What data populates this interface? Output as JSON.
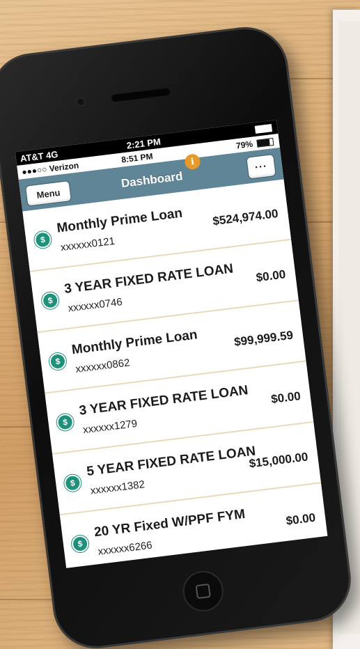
{
  "outer_status": {
    "carrier": "AT&T 4G",
    "time": "2:21 PM"
  },
  "inner_status": {
    "carrier": "●●●○○ Verizon",
    "time": "8:51 PM",
    "battery_text": "79%"
  },
  "header": {
    "title": "Dashboard",
    "menu_label": "Menu",
    "more_label": "···",
    "badge_label": "i"
  },
  "accounts": [
    {
      "name": "Monthly Prime Loan",
      "number": "xxxxxx0121",
      "balance": "$524,974.00"
    },
    {
      "name": "3 YEAR FIXED RATE LOAN",
      "number": "xxxxxx0746",
      "balance": "$0.00"
    },
    {
      "name": "Monthly Prime Loan",
      "number": "xxxxxx0862",
      "balance": "$99,999.59"
    },
    {
      "name": "3 YEAR FIXED RATE LOAN",
      "number": "xxxxxx1279",
      "balance": "$0.00"
    },
    {
      "name": "5 YEAR FIXED RATE LOAN",
      "number": "xxxxxx1382",
      "balance": "$15,000.00"
    },
    {
      "name": "20 YR Fixed W/PPF FYM",
      "number": "xxxxxx6266",
      "balance": "$0.00"
    }
  ],
  "colors": {
    "header_bg": "#5f8597",
    "icon_green": "#1f9079",
    "badge_orange": "#e59a2b",
    "divider_tan": "#e7d8b9"
  },
  "icons": {
    "account": "dollar-circle-icon",
    "badge": "info-icon",
    "more": "ellipsis-icon"
  }
}
